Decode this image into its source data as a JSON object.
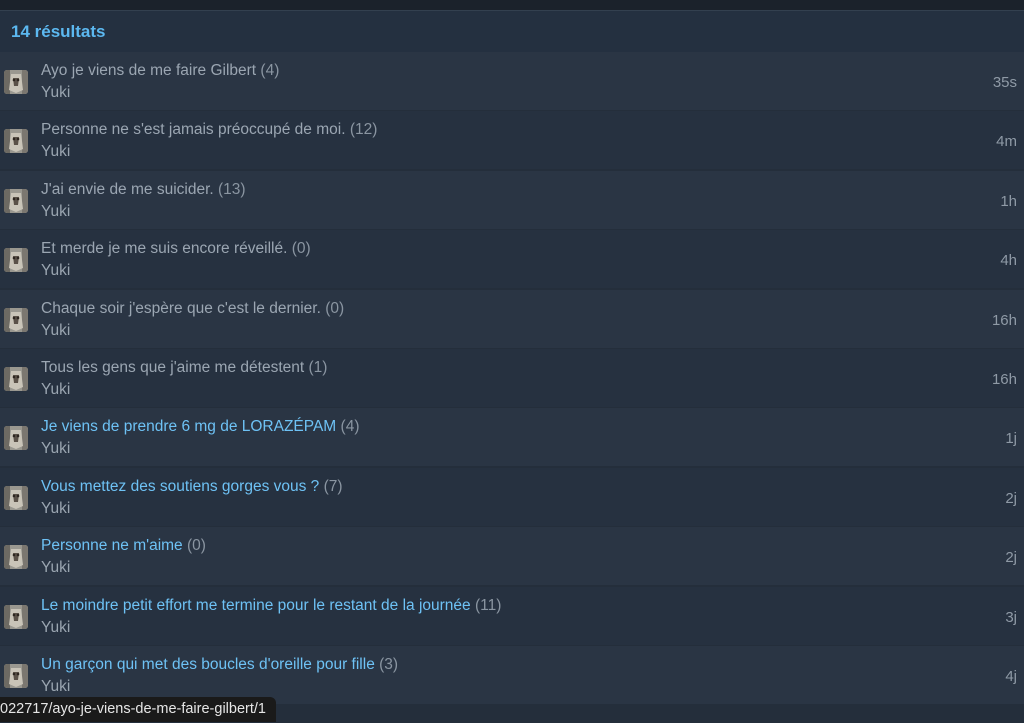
{
  "results_label": "14 résultats",
  "rows": [
    {
      "title": "Ayo je viens de me faire Gilbert",
      "count": "(4)",
      "author": "Yuki",
      "time": "35s",
      "link": false
    },
    {
      "title": "Personne ne s'est jamais préoccupé de moi.",
      "count": "(12)",
      "author": "Yuki",
      "time": "4m",
      "link": false
    },
    {
      "title": "J'ai envie de me suicider.",
      "count": "(13)",
      "author": "Yuki",
      "time": "1h",
      "link": false
    },
    {
      "title": "Et merde je me suis encore réveillé.",
      "count": "(0)",
      "author": "Yuki",
      "time": "4h",
      "link": false
    },
    {
      "title": "Chaque soir j'espère que c'est le dernier.",
      "count": "(0)",
      "author": "Yuki",
      "time": "16h",
      "link": false
    },
    {
      "title": "Tous les gens que j'aime me détestent",
      "count": "(1)",
      "author": "Yuki",
      "time": "16h",
      "link": false
    },
    {
      "title": "Je viens de prendre 6 mg de LORAZÉPAM",
      "count": "(4)",
      "author": "Yuki",
      "time": "1j",
      "link": true
    },
    {
      "title": "Vous mettez des soutiens gorges vous ?",
      "count": "(7)",
      "author": "Yuki",
      "time": "2j",
      "link": true
    },
    {
      "title": "Personne ne m'aime",
      "count": "(0)",
      "author": "Yuki",
      "time": "2j",
      "link": true
    },
    {
      "title": "Le moindre petit effort me termine pour le restant de la journée",
      "count": "(11)",
      "author": "Yuki",
      "time": "3j",
      "link": true
    },
    {
      "title": "Un garçon qui met des boucles d'oreille pour fille",
      "count": "(3)",
      "author": "Yuki",
      "time": "4j",
      "link": true
    }
  ],
  "status_url": "022717/ayo-je-viens-de-me-faire-gilbert/1",
  "colors": {
    "link": "#6ec2f5",
    "visited": "#9ba6b2",
    "header": "#5cb8f0"
  }
}
